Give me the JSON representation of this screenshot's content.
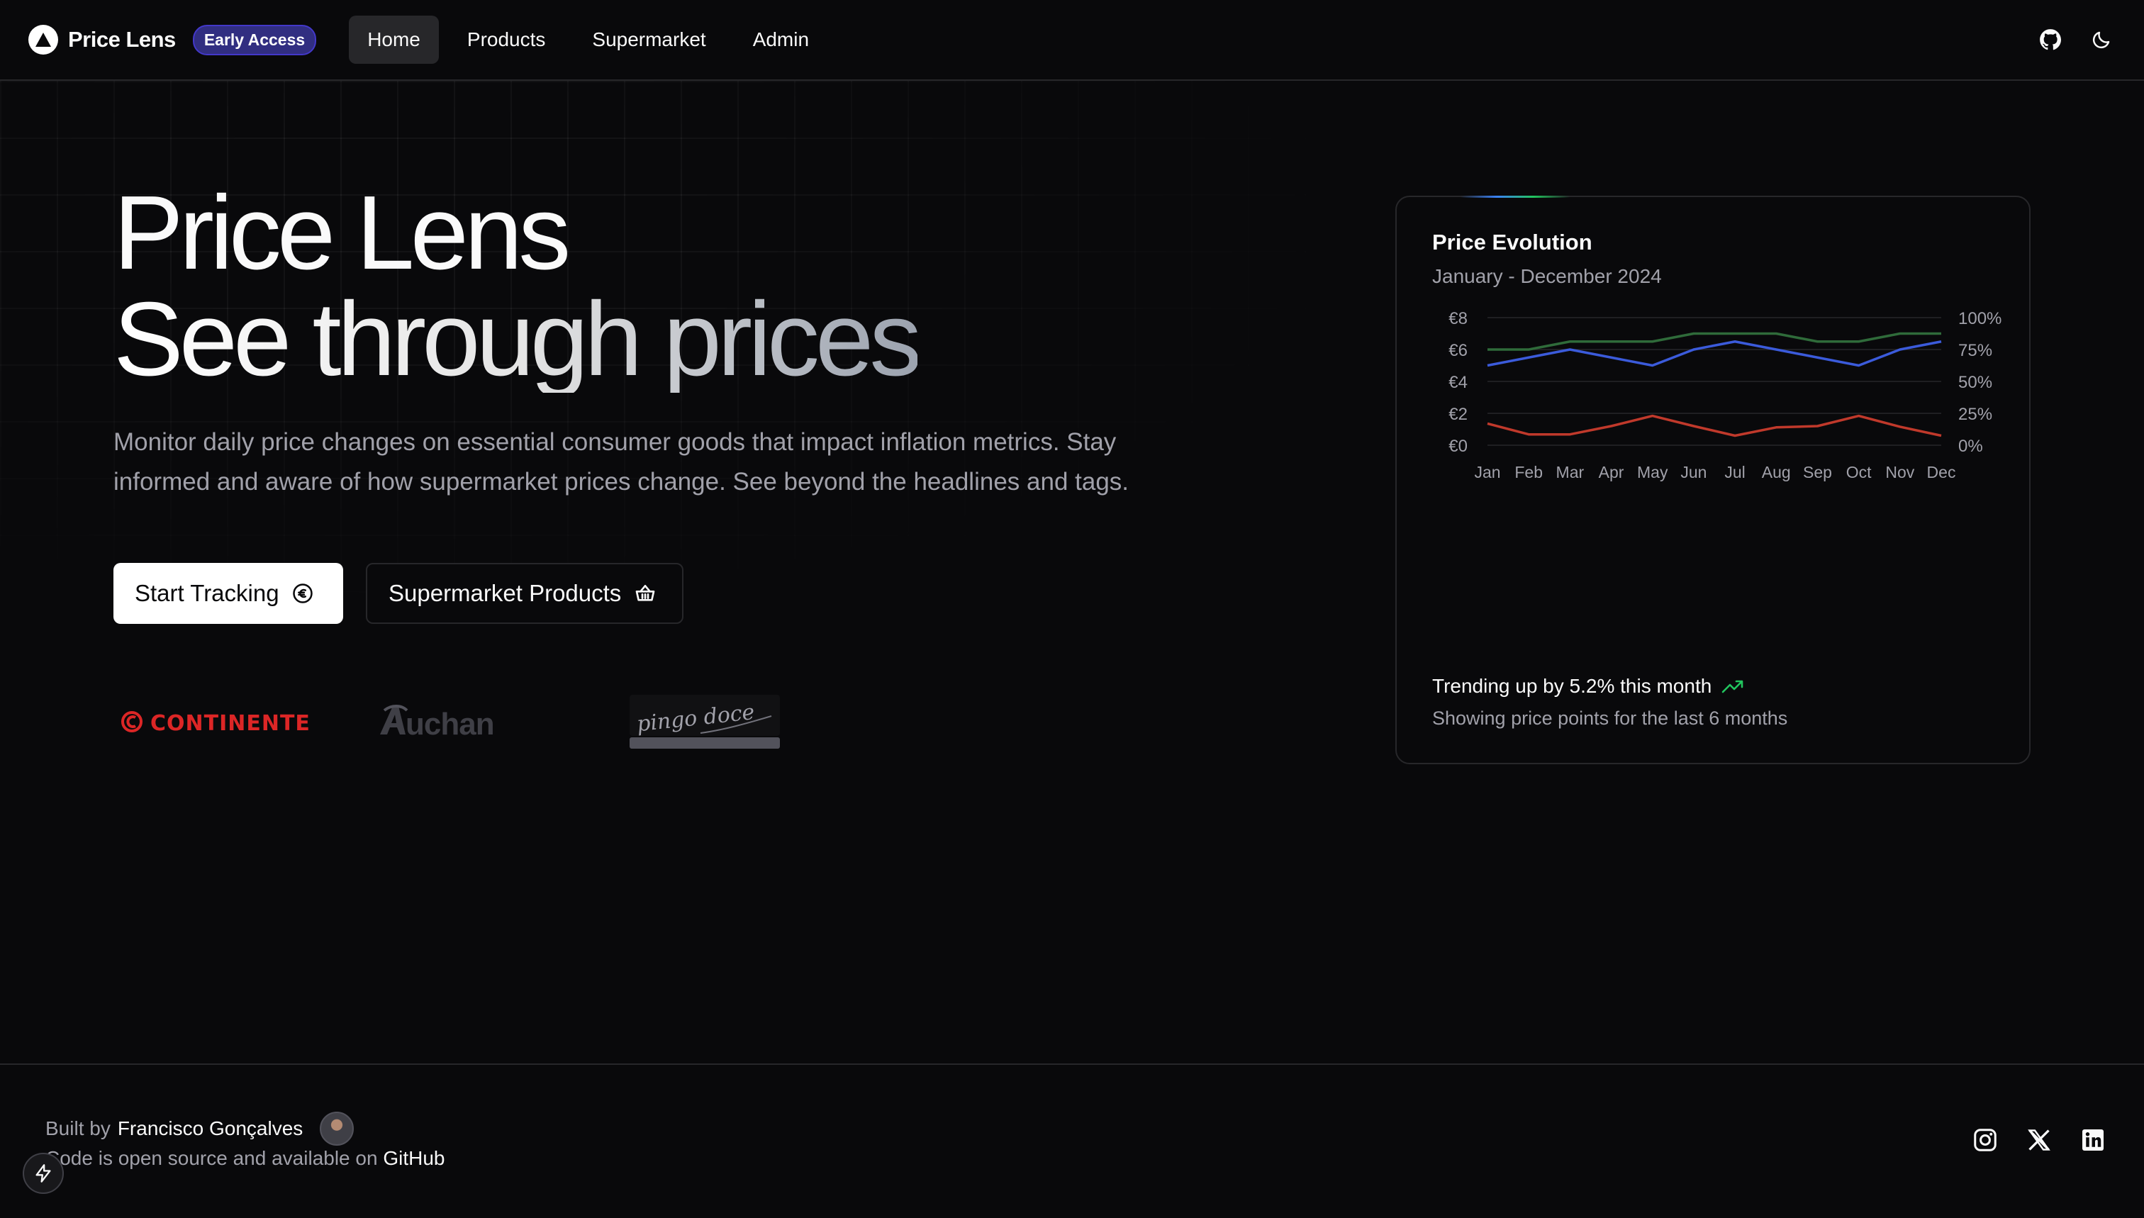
{
  "header": {
    "brand": "Price Lens",
    "badge": "Early Access",
    "nav": [
      {
        "label": "Home",
        "active": true
      },
      {
        "label": "Products"
      },
      {
        "label": "Supermarket"
      },
      {
        "label": "Admin"
      }
    ],
    "icons": [
      "github-icon",
      "moon-icon"
    ]
  },
  "hero": {
    "title_line1": "Price Lens",
    "title_line2": "See through prices",
    "description": "Monitor daily price changes on essential consumer goods that impact inflation metrics. Stay informed and aware of how supermarket prices change. See beyond the headlines and tags.",
    "primary_button": "Start Tracking",
    "secondary_button": "Supermarket Products",
    "brand_logos": [
      "CONTINENTE",
      "Auchan",
      "pingo doce"
    ]
  },
  "card": {
    "title": "Price Evolution",
    "subtitle": "January - December 2024",
    "trend_text": "Trending up by 5.2% this month",
    "footer_text": "Showing price points for the last 6 months",
    "accent_colors": {
      "green": "#2f6b3a",
      "blue": "#3b5bdb",
      "red": "#c0392b"
    }
  },
  "chart_data": {
    "type": "line",
    "categories": [
      "Jan",
      "Feb",
      "Mar",
      "Apr",
      "May",
      "Jun",
      "Jul",
      "Aug",
      "Sep",
      "Oct",
      "Nov",
      "Dec"
    ],
    "y_left_ticks": [
      "€0",
      "€2",
      "€4",
      "€6",
      "€8"
    ],
    "y_right_ticks": [
      "0%",
      "25%",
      "50%",
      "75%",
      "100%"
    ],
    "ylim_left": [
      0,
      8
    ],
    "ylim_right": [
      0,
      100
    ],
    "grid": true,
    "series": [
      {
        "axis": "left",
        "color": "#2f6b3a",
        "values": [
          6.0,
          6.0,
          6.5,
          6.5,
          6.5,
          7.0,
          7.0,
          7.0,
          6.5,
          6.5,
          7.0,
          7.0
        ]
      },
      {
        "axis": "left",
        "color": "#3b5bdb",
        "values": [
          5.0,
          5.5,
          6.0,
          5.5,
          5.0,
          6.0,
          6.5,
          6.0,
          5.5,
          5.0,
          6.0,
          6.5
        ]
      },
      {
        "axis": "right",
        "color": "#c0392b",
        "values": [
          17,
          8.5,
          8.5,
          15,
          23,
          15,
          7.5,
          14,
          15,
          23,
          14.5,
          7.5
        ]
      }
    ]
  },
  "footer": {
    "built_by_prefix": "Built by",
    "author": "Francisco Gonçalves",
    "open_source_prefix": "Code is open source and available on",
    "repo_link": "GitHub",
    "socials": [
      "instagram-icon",
      "x-icon",
      "linkedin-icon"
    ]
  }
}
